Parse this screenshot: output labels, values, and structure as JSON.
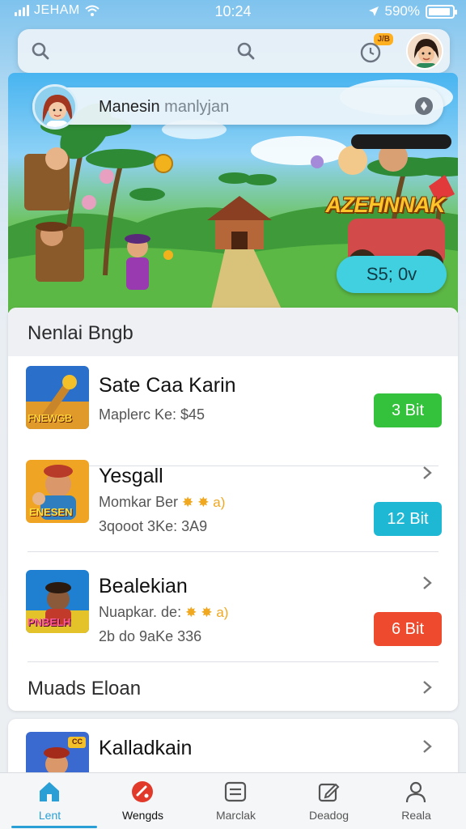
{
  "status_bar": {
    "carrier": "JEHAM",
    "time": "10:24",
    "battery": "590%"
  },
  "top_bar": {
    "notification_badge": "J/B"
  },
  "hero": {
    "search_text_main": "Manesin",
    "search_text_dim": "manlyjan",
    "game_title": "AZEHNNAK",
    "cta_label": "S5; 0v"
  },
  "section": {
    "title": "Nenlai Bngb"
  },
  "items": [
    {
      "title": "Sate Caa Karin",
      "line1": "Maplerc Ke: $45",
      "line2": "",
      "price": "3 Bit",
      "price_color": "#34c13c",
      "thumb_text": "FNEWGB"
    },
    {
      "title": "Yesgall",
      "line1": "Momkar Ber",
      "line2": "3qooot 3Ke: 3A9",
      "price": "12 Bit",
      "price_color": "#1fb8d4",
      "thumb_text": "ENESEN"
    },
    {
      "title": "Bealekian",
      "line1": "Nuapkar. de:",
      "line2": "2b do 9aKe 336",
      "price": "6 Bit",
      "price_color": "#ee4a2e",
      "thumb_text": "PNBELH"
    }
  ],
  "more": {
    "label": "Muads Eloan"
  },
  "card2": {
    "title": "Kalladkain",
    "thumb_badge": "CC"
  },
  "tabs": [
    {
      "label": "Lent",
      "icon": "home-icon"
    },
    {
      "label": "Wengds",
      "icon": "games-icon"
    },
    {
      "label": "Marclak",
      "icon": "list-icon"
    },
    {
      "label": "Deadog",
      "icon": "edit-icon"
    },
    {
      "label": "Reala",
      "icon": "profile-icon"
    }
  ],
  "colors": {
    "accent": "#2a9fd6",
    "green": "#34c13c",
    "teal": "#1fb8d4",
    "red": "#ee4a2e"
  }
}
